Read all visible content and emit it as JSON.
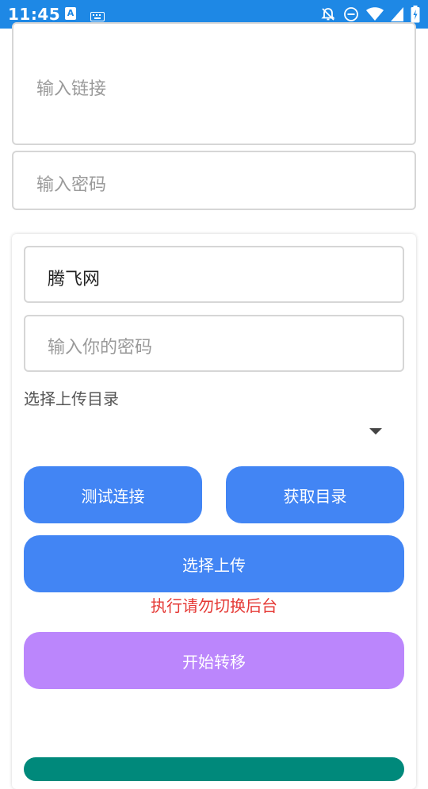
{
  "status_bar": {
    "time": "11:45",
    "icons": [
      "a-icon",
      "keyboard-icon",
      "notifications-off-icon",
      "dnd-icon",
      "wifi-icon",
      "signal-icon",
      "battery-charging-icon"
    ],
    "bg_color": "#1e88e5"
  },
  "form": {
    "link_placeholder": "输入链接",
    "password_placeholder": "输入密码"
  },
  "upload_card": {
    "account_value": "腾飞网",
    "your_password_placeholder": "输入你的密码",
    "directory_label": "选择上传目录",
    "directory_selected": ""
  },
  "buttons": {
    "test_connection": "测试连接",
    "get_directory": "获取目录",
    "select_upload": "选择上传",
    "start_transfer": "开始转移"
  },
  "warning_text": "执行请勿切换后台",
  "colors": {
    "primary_button": "#4285f4",
    "start_button": "#bb86fc",
    "warning": "#e53935",
    "bottom_button": "#00897b"
  }
}
